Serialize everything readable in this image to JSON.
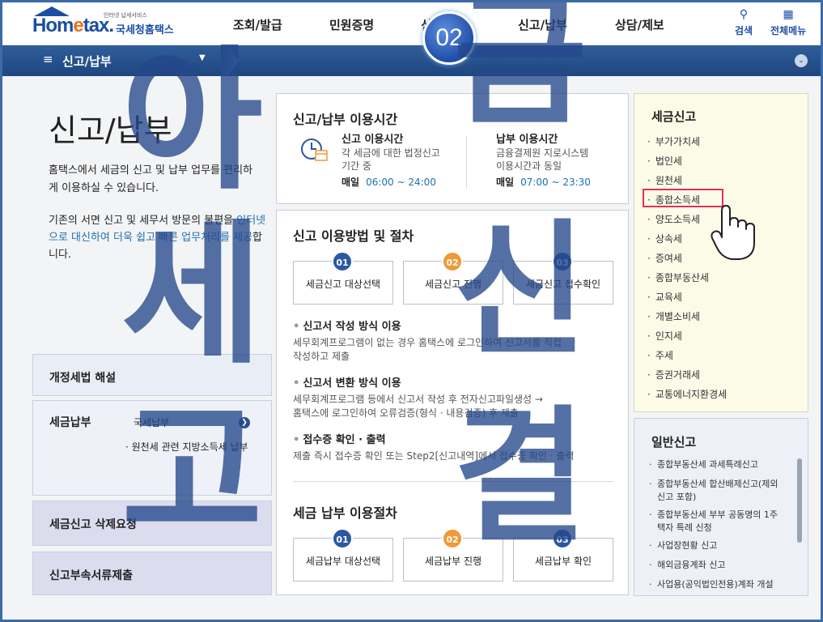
{
  "header": {
    "logo_small": "인터넷 납세서비스",
    "logo_home": "Hom",
    "logo_e": "e",
    "logo_tax": "tax.",
    "logo_kr": "국세청홈택스",
    "nav": [
      "조회/발급",
      "민원증명",
      "신청/제출",
      "신고/납부",
      "상담/제보"
    ],
    "search_label": "검색",
    "allmenu_label": "전체메뉴",
    "step_badge": "02"
  },
  "subbar": {
    "menu_label": "신고/납부"
  },
  "left": {
    "title": "신고/납부",
    "intro1": "홈택스에서 세금의 신고 및 납부 업무를 편리하게 이용하실 수 있습니다.",
    "intro2_a": "기존의 서면 신고 및 세무서 방문의 불편을",
    "intro2_b": "인터넷으로 대신하여 더욱 쉽고 빠른 업무처리를 제공",
    "intro2_c": "합니다.",
    "box_reform": "개정세법 해설",
    "box_pay": "세금납부",
    "pay_item1": "국세납부",
    "pay_item2": "· 원천세 관련 지방소득세 납부",
    "box_delete": "세금신고 삭제요청",
    "box_docs": "신고부속서류제출"
  },
  "hours": {
    "title": "신고/납부 이용시간",
    "file_h": "신고 이용시간",
    "file_d1": "각 세금에 대한 법정신고",
    "file_d2": "기간 중",
    "file_day": "매일",
    "file_time": "06:00 ~ 24:00",
    "pay_h": "납부 이용시간",
    "pay_d1": "금융결제원 지로시스템",
    "pay_d2": "이용시간과 동일",
    "pay_day": "매일",
    "pay_time": "07:00 ~ 23:30"
  },
  "procedure": {
    "title": "신고 이용방법 및 절차",
    "steps": [
      {
        "num": "01",
        "label": "세금신고 대상선택"
      },
      {
        "num": "02",
        "label": "세금신고 진행"
      },
      {
        "num": "03",
        "label": "세금신고 접수확인"
      }
    ],
    "m1_h": "신고서 작성 방식 이용",
    "m1_d1": "세무회계프로그램이 없는 경우 홈택스에 로그인하여 신고서를 직접",
    "m1_d2": "작성하고 제출",
    "m2_h": "신고서 변환 방식 이용",
    "m2_d1": "세무회계프로그램 등에서 신고서 작성 후 전자신고파일생성 →",
    "m2_d2": "홈택스에 로그인하여 오류검증(형식 · 내용검증) 후 제출",
    "m3_h": "접수증 확인 · 출력",
    "m3_d1": "제출 즉시 접수증 확인 또는 Step2[신고내역]에서 접수증 확인 · 출력",
    "pay_title": "세금 납부 이용절차",
    "pay_steps": [
      {
        "num": "01",
        "label": "세금납부 대상선택"
      },
      {
        "num": "02",
        "label": "세금납부 진행"
      },
      {
        "num": "03",
        "label": "세금납부 확인"
      }
    ]
  },
  "tax_filing": {
    "title": "세금신고",
    "items": [
      "부가가치세",
      "법인세",
      "원천세",
      "종합소득세",
      "양도소득세",
      "상속세",
      "증여세",
      "종합부동산세",
      "교육세",
      "개별소비세",
      "인지세",
      "주세",
      "증권거래세",
      "교통에너지환경세"
    ]
  },
  "general_filing": {
    "title": "일반신고",
    "items": [
      "종합부동산세 과세특례신고",
      "종합부동산세 합산배제신고(제외신고 포함)",
      "종합부동산세 부부 공동명의 1주택자 특례 신청",
      "사업장현황 신고",
      "해외금융계좌 신고",
      "사업용(공익법인전용)계좌 개설"
    ]
  },
  "watermark": {
    "c1": "아",
    "c2": "세",
    "c3": "금",
    "c4": "신",
    "c5": "고",
    "c6": "결"
  },
  "colors": {
    "brand": "#1b4ea3",
    "accent": "#ef9a35",
    "highlight": "#e0315a",
    "subbar": "#2f5d9a"
  }
}
